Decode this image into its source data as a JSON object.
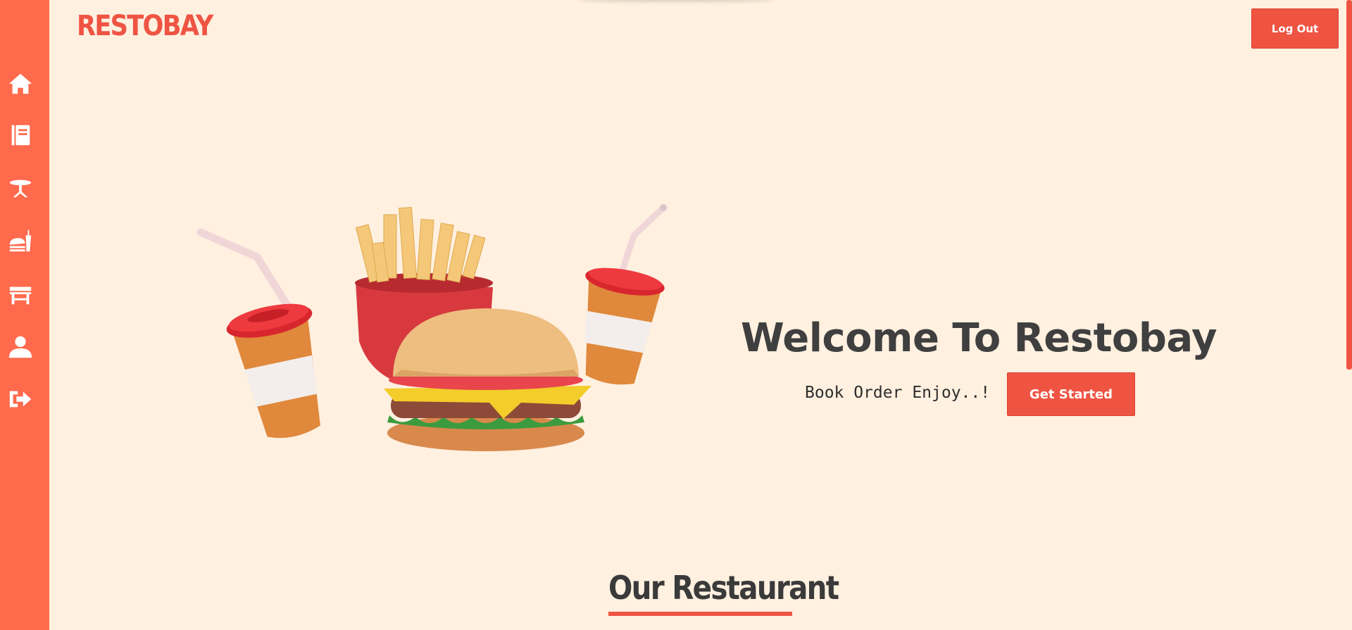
{
  "header": {
    "brand": "RESTOBAY",
    "logout_label": "Log Out"
  },
  "sidebar": {
    "items": [
      {
        "icon": "home-icon"
      },
      {
        "icon": "menu-book-icon"
      },
      {
        "icon": "table-reservation-icon"
      },
      {
        "icon": "food-order-icon"
      },
      {
        "icon": "tables-icon"
      },
      {
        "icon": "user-profile-icon"
      },
      {
        "icon": "sign-out-icon"
      }
    ]
  },
  "hero": {
    "title": "Welcome To Restobay",
    "tagline": "Book Order Enjoy..!",
    "cta_label": "Get Started",
    "image": "fast-food-illustration"
  },
  "sections": {
    "restaurant_title": "Our Restaurant"
  },
  "colors": {
    "accent": "#ef5443",
    "sidebar": "#ff6a4d",
    "background": "#fff0e0",
    "text": "#3f3f3f"
  }
}
